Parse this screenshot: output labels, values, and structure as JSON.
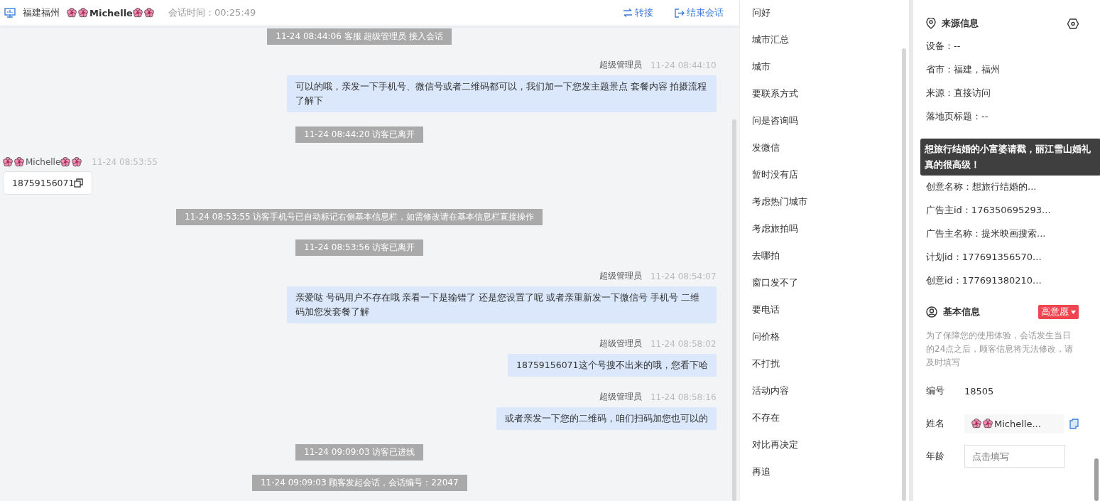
{
  "header": {
    "location": "福建福州",
    "visitor": "Michelle",
    "duration": "会话时间：00:25:49",
    "actions": [
      {
        "kind": "transfer",
        "label": "转接"
      },
      {
        "kind": "end",
        "label": "结束会话"
      }
    ]
  },
  "messages": [
    {
      "kind": "system",
      "text": "11-24 08:44:06 客服 超级管理员 接入会话"
    },
    {
      "kind": "agent",
      "sender": "超级管理员",
      "time": "11-24 08:44:10",
      "text": "可以的哦，亲发一下手机号、微信号或者二维码都可以，我们加一下您发主题景点 套餐内容 拍摄流程了解下"
    },
    {
      "kind": "system",
      "text": "11-24 08:44:20 访客已离开"
    },
    {
      "kind": "visitor",
      "sender": "Michelle",
      "time": "11-24 08:53:55",
      "text": "18759156071"
    },
    {
      "kind": "system",
      "text": "11-24 08:53:55 访客手机号已自动标记右侧基本信息栏，如需修改请在基本信息栏直接操作"
    },
    {
      "kind": "system",
      "text": "11-24 08:53:56 访客已离开"
    },
    {
      "kind": "agent",
      "sender": "超级管理员",
      "time": "11-24 08:54:07",
      "text": "亲爱哒 号码用户不存在哦 亲看一下是输错了 还是您设置了呢 或者亲重新发一下微信号 手机号 二维码加您发套餐了解"
    },
    {
      "kind": "agent",
      "sender": "超级管理员",
      "time": "11-24 08:58:02",
      "text": "18759156071这个号搜不出来的哦，您看下哈"
    },
    {
      "kind": "agent",
      "sender": "超级管理员",
      "time": "11-24 08:58:16",
      "text": "或者亲发一下您的二维码，咱们扫码加您也可以的"
    },
    {
      "kind": "system",
      "text": "11-24 09:09:03 访客已进线"
    },
    {
      "kind": "system",
      "text": "11-24 09:09:03 顾客发起会话，会话编号：22047"
    }
  ],
  "quick_replies": [
    "问好",
    "城市汇总",
    "城市",
    "要联系方式",
    "问是咨询吗",
    "发微信",
    "暂时没有店",
    "考虑热门城市",
    "考虑旅拍吗",
    "去哪拍",
    "窗口发不了",
    "要电话",
    "问价格",
    "不打扰",
    "活动内容",
    "不存在",
    "对比再决定",
    "再追"
  ],
  "source_info": {
    "title": "来源信息",
    "rows_top": [
      "设备：--",
      "省市：福建，福州",
      "来源：直接访问",
      "落地页标题：--"
    ],
    "tooltip": "想旅行结婚的小富婆请戳，丽江雪山婚礼真的很高级！",
    "rows_bottom": [
      "创意名称：想旅行结婚的...",
      "广告主id：176350695293...",
      "广告主名称：提米映画搜索...",
      "计划id：177691356570...",
      "创意id：177691380210..."
    ]
  },
  "basic_info": {
    "title": "基本信息",
    "intent": "高意愿",
    "notice": "为了保障您的使用体验，会话发生当日的24点之后，顾客信息将无法修改，请及时填写",
    "fields": [
      {
        "kind": "text",
        "label": "编号",
        "value": "18505"
      },
      {
        "kind": "name",
        "label": "姓名",
        "value": "Michelle..."
      },
      {
        "kind": "input",
        "label": "年龄",
        "placeholder": "点击填写"
      }
    ]
  }
}
